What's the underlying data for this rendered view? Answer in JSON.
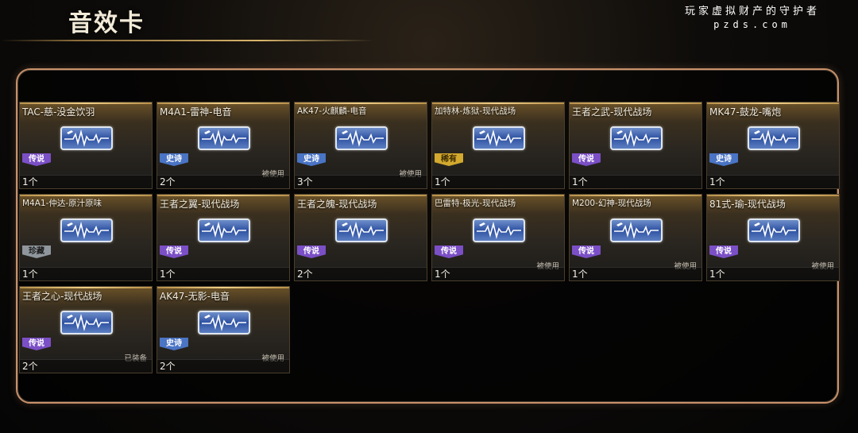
{
  "header": {
    "title": "音效卡",
    "watermark_line1": "玩家虚拟财产的守护者",
    "watermark_line2": "pzds.com"
  },
  "colors": {
    "panel_border": "#c8906a",
    "legend_badge": "#7b4fc6",
    "epic_badge": "#4a74c4",
    "rare_badge": "#d3a92f",
    "common_badge": "#8f969c"
  },
  "cards": [
    {
      "name": "TAC-慈-没金饮羽",
      "rarity": "传说",
      "tier": "legend",
      "status": "",
      "count": "1个"
    },
    {
      "name": "M4A1-雷神-电音",
      "rarity": "史诗",
      "tier": "epic",
      "status": "被使用",
      "count": "2个"
    },
    {
      "name": "AK47-火麒麟-电音",
      "rarity": "史诗",
      "tier": "epic",
      "status": "被使用",
      "count": "3个"
    },
    {
      "name": "加特林-炼狱-现代战场",
      "rarity": "稀有",
      "tier": "rare",
      "status": "",
      "count": "1个"
    },
    {
      "name": "王者之武-现代战场",
      "rarity": "传说",
      "tier": "legend",
      "status": "",
      "count": "1个"
    },
    {
      "name": "MK47-鼓龙-嘴炮",
      "rarity": "史诗",
      "tier": "epic",
      "status": "",
      "count": "1个"
    },
    {
      "name": "M4A1-仲达-原汁原味",
      "rarity": "珍藏",
      "tier": "common",
      "status": "",
      "count": "1个"
    },
    {
      "name": "王者之翼-现代战场",
      "rarity": "传说",
      "tier": "legend",
      "status": "",
      "count": "1个"
    },
    {
      "name": "王者之魄-现代战场",
      "rarity": "传说",
      "tier": "legend",
      "status": "",
      "count": "2个"
    },
    {
      "name": "巴雷特-极光-现代战场",
      "rarity": "传说",
      "tier": "legend",
      "status": "被使用",
      "count": "1个"
    },
    {
      "name": "M200-幻神-现代战场",
      "rarity": "传说",
      "tier": "legend",
      "status": "被使用",
      "count": "1个"
    },
    {
      "name": "81式-瑜-现代战场",
      "rarity": "传说",
      "tier": "legend",
      "status": "被使用",
      "count": "1个"
    },
    {
      "name": "王者之心-现代战场",
      "rarity": "传说",
      "tier": "legend",
      "status": "已装备",
      "count": "2个"
    },
    {
      "name": "AK47-无影-电音",
      "rarity": "史诗",
      "tier": "epic",
      "status": "被使用",
      "count": "2个"
    }
  ]
}
